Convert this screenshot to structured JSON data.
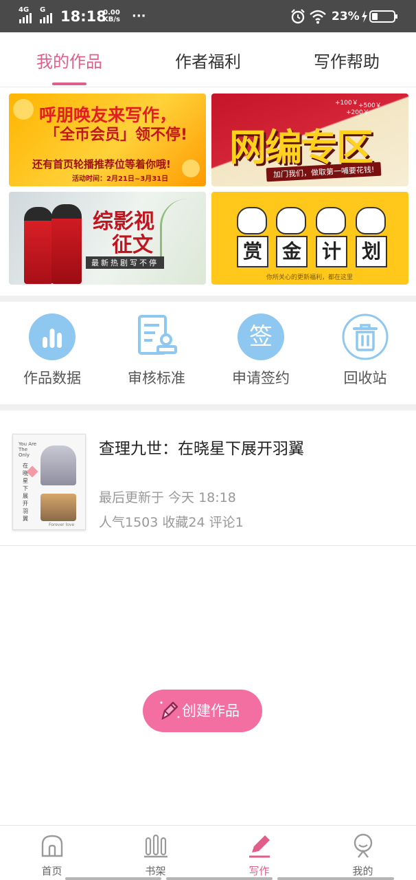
{
  "status_bar": {
    "network1": "4G",
    "network2": "G",
    "time": "18:18",
    "speed_value": "0.00",
    "speed_unit": "KB/s",
    "more": "···",
    "battery": "23%"
  },
  "tabs": [
    {
      "label": "我的作品",
      "active": true
    },
    {
      "label": "作者福利",
      "active": false
    },
    {
      "label": "写作帮助",
      "active": false
    }
  ],
  "banners": {
    "b1": {
      "line1": "呼朋唤友来写作，",
      "line2": "「全币会员」领不停!",
      "line3": "还有首页轮播推荐位等着你哦!",
      "date": "活动时间：2月21日~3月31日"
    },
    "b2": {
      "title": "网编专区",
      "sub": "加门我们，做取第一哺要花钱!",
      "bonus1": "+100￥",
      "bonus2": "+500￥",
      "bonus3": "+200￥"
    },
    "b3": {
      "title1": "综影视",
      "title2": "征文",
      "sub": "最新热剧写不停"
    },
    "b4": {
      "chars": [
        "赏",
        "金",
        "计",
        "划"
      ],
      "sub": "你所关心的更新福利，都在这里"
    }
  },
  "quick_actions": [
    {
      "label": "作品数据",
      "icon": "bar-chart-icon"
    },
    {
      "label": "审核标准",
      "icon": "document-stamp-icon"
    },
    {
      "label": "申请签约",
      "icon": "sign-icon"
    },
    {
      "label": "回收站",
      "icon": "trash-icon"
    }
  ],
  "sign_char": "签",
  "work": {
    "title": "查理九世：在晓星下展开羽翼",
    "updated": "最后更新于 今天 18:18",
    "stats": "人气1503 收藏24 评论1",
    "cover_text1": "You Are The Only",
    "cover_text2": "在晓星下展开羽翼",
    "cover_footer": "Forever love"
  },
  "create_button": "创建作品",
  "bottom_nav": [
    {
      "label": "首页",
      "icon": "home-icon",
      "active": false
    },
    {
      "label": "书架",
      "icon": "bookshelf-icon",
      "active": false
    },
    {
      "label": "写作",
      "icon": "pen-icon",
      "active": true
    },
    {
      "label": "我的",
      "icon": "profile-icon",
      "active": false
    }
  ],
  "colors": {
    "accent": "#e05f8a",
    "create_button": "#f36fa1",
    "icon_blue": "#8ec7ef",
    "status_bar": "#4a4a4a"
  }
}
